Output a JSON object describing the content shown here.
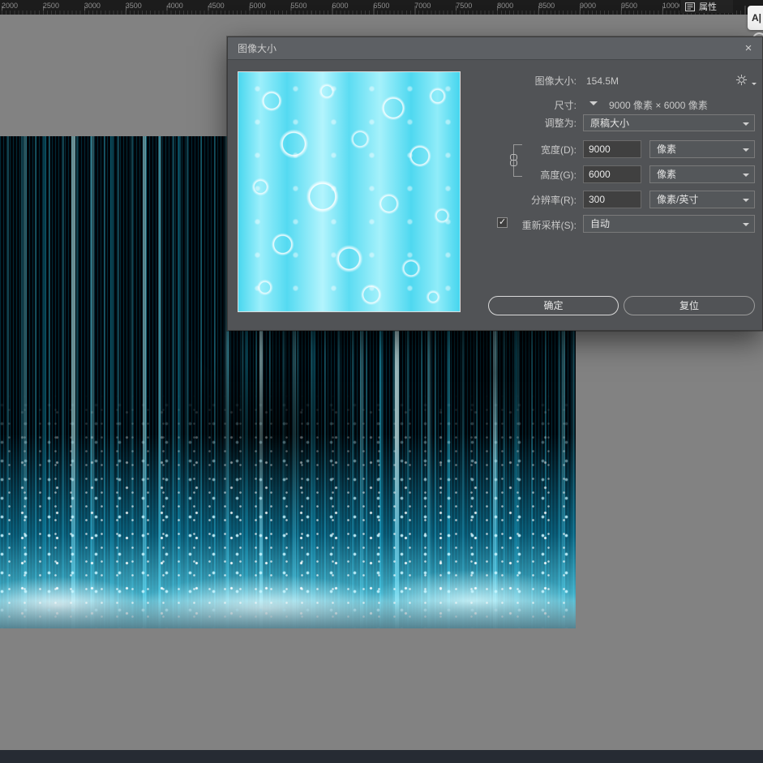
{
  "colors": {
    "canvas_accent": "#3fd6f2",
    "dialog_bg": "#515356",
    "surround": "#828282"
  },
  "ruler": {
    "ticks": [
      "2000",
      "2500",
      "3000",
      "3500",
      "4000",
      "4500",
      "5000",
      "5500",
      "6000",
      "6500",
      "7000",
      "7500",
      "8000",
      "8500",
      "9000",
      "9500",
      "10000"
    ]
  },
  "top_right": {
    "properties_tab": "属性",
    "tool_hint": "A|"
  },
  "dialog": {
    "title": "图像大小",
    "close_x": "×",
    "image_size_label": "图像大小:",
    "image_size_value": "154.5M",
    "dimensions_label": "尺寸:",
    "dimensions_value": "9000 像素 × 6000 像素",
    "fit_label": "调整为:",
    "fit_value": "原稿大小",
    "width_label": "宽度(D):",
    "width_value": "9000",
    "width_unit": "像素",
    "height_label": "高度(G):",
    "height_value": "6000",
    "height_unit": "像素",
    "resolution_label": "分辨率(R):",
    "resolution_value": "300",
    "resolution_unit": "像素/英寸",
    "resample_label": "重新采样(S):",
    "resample_checked": true,
    "resample_value": "自动",
    "ok": "确定",
    "reset": "复位"
  }
}
